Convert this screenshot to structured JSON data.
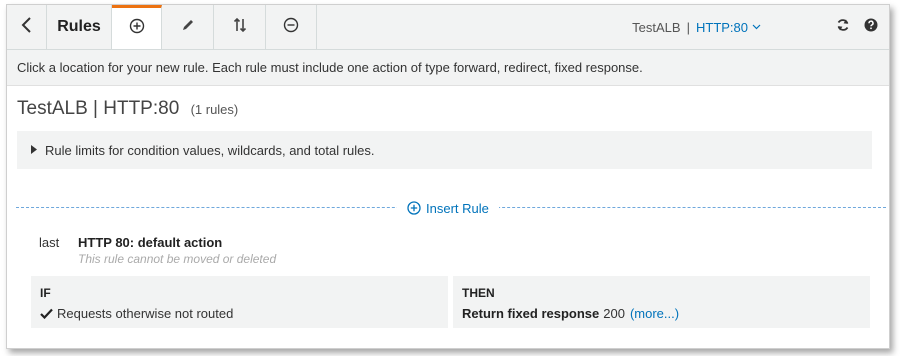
{
  "toolbar": {
    "back_icon": "chevron-left-icon",
    "title": "Rules",
    "tabs": [
      {
        "name": "add",
        "icon": "plus-circle-icon"
      },
      {
        "name": "edit",
        "icon": "pencil-icon"
      },
      {
        "name": "reorder",
        "icon": "sort-arrows-icon"
      },
      {
        "name": "delete",
        "icon": "minus-circle-icon"
      }
    ],
    "load_balancer": "TestALB",
    "separator": "|",
    "listener": "HTTP:80",
    "refresh_icon": "refresh-icon",
    "help_icon": "help-icon",
    "accent_color": "#ec7211"
  },
  "info": {
    "message": "Click a location for your new rule. Each rule must include one action of type forward, redirect, fixed response."
  },
  "page": {
    "title": "TestALB | HTTP:80",
    "rule_count": "(1 rules)"
  },
  "limits": {
    "label": "Rule limits for condition values, wildcards, and total rules."
  },
  "insert": {
    "label": "Insert Rule"
  },
  "rule": {
    "position": "last",
    "name": "HTTP 80: default action",
    "note": "This rule cannot be moved or deleted",
    "if_header": "IF",
    "condition": "Requests otherwise not routed",
    "then_header": "THEN",
    "action": "Return fixed response",
    "status_code": "200",
    "more_link": "(more...)"
  },
  "colors": {
    "link": "#0073bb",
    "panel_bg": "#f2f3f3"
  }
}
